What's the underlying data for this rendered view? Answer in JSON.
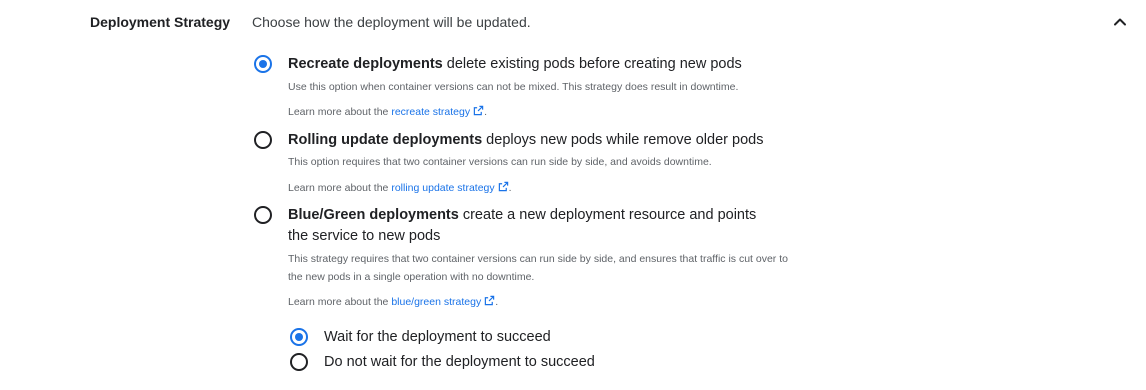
{
  "section": {
    "label": "Deployment Strategy",
    "description": "Choose how the deployment will be updated."
  },
  "options": [
    {
      "title_bold": "Recreate deployments",
      "title_rest": " delete existing pods before creating new pods",
      "help": "Use this option when container versions can not be mixed. This strategy does result in downtime.",
      "learn_prefix": "Learn more about the ",
      "learn_link": "recreate strategy",
      "learn_suffix": ".",
      "selected": true
    },
    {
      "title_bold": "Rolling update deployments",
      "title_rest": " deploys new pods while remove older pods",
      "help": "This option requires that two container versions can run side by side, and avoids downtime.",
      "learn_prefix": "Learn more about the ",
      "learn_link": "rolling update strategy",
      "learn_suffix": ".",
      "selected": false
    },
    {
      "title_bold": "Blue/Green deployments",
      "title_rest": " create a new deployment resource and points the service to new pods",
      "help": "This strategy requires that two container versions can run side by side, and ensures that traffic is cut over to the new pods in a single operation with no downtime.",
      "learn_prefix": "Learn more about the ",
      "learn_link": "blue/green strategy",
      "learn_suffix": ".",
      "selected": false
    }
  ],
  "wait_options": [
    {
      "label": "Wait for the deployment to succeed",
      "selected": true
    },
    {
      "label": "Do not wait for the deployment to succeed",
      "selected": false
    }
  ],
  "colors": {
    "accent": "#1a73e8",
    "text": "#202124",
    "muted": "#5f6368"
  },
  "icons": {
    "collapse": "chevron-up-icon",
    "external": "external-link-icon"
  }
}
